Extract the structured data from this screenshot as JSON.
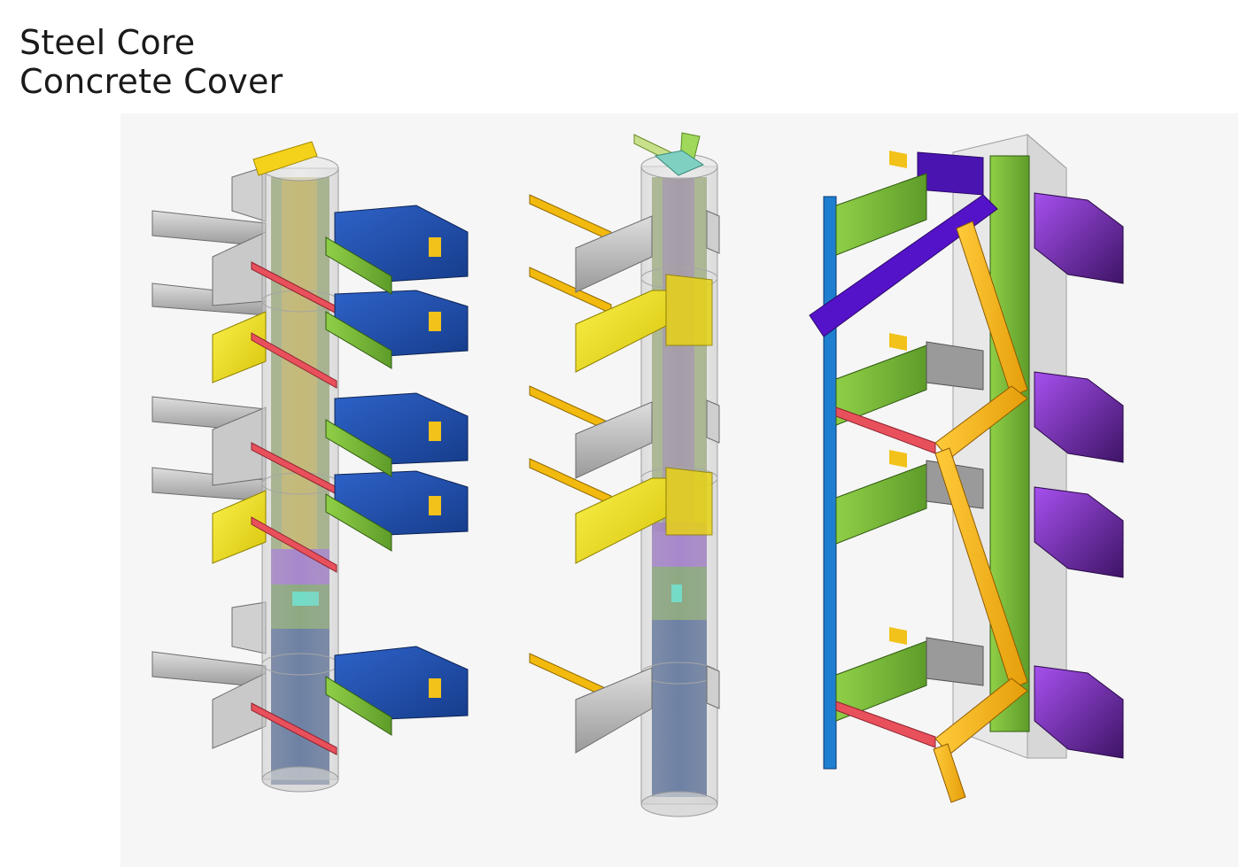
{
  "title": {
    "line1": "Steel Core",
    "line2": "Concrete Cover"
  },
  "colors": {
    "concrete": "#d6d6d6",
    "grey_steel": "#bdbdbd",
    "blue": "#1f4da8",
    "navy": "#2c4a80",
    "green": "#79b83a",
    "yellow": "#f2e21a",
    "orange": "#f7b514",
    "red": "#e8505b",
    "purple": "#8c2be0",
    "violet": "#5513c9",
    "cyan_blue": "#1e7fd0",
    "teal": "#35d6b5"
  }
}
